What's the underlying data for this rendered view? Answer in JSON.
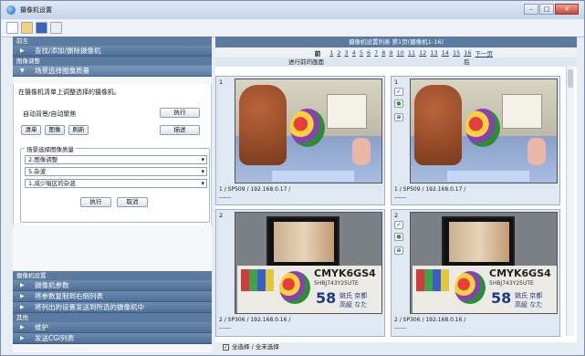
{
  "window": {
    "title": "摄像机设置",
    "buttons": [
      "–",
      "□",
      "✕"
    ]
  },
  "toolbar": {
    "icons": [
      "new-icon",
      "open-icon",
      "save-icon",
      "document-icon"
    ]
  },
  "left": {
    "sec_front": "前言",
    "item_find": "查找/添加/删除摄像机",
    "sec_image": "图像调整",
    "item_scene": "场景选择图像质量",
    "note": "在摄像机清单上调整选择的摄像机。",
    "auto_label": "自动背景/自动聚焦",
    "btn_exec1": "执行",
    "btn_clear": "清单",
    "btn_image": "图像",
    "btn_refresh": "刷新",
    "btn_describe": "描述",
    "group_legend": "场景选择图像质量",
    "select1": "2.图像调整",
    "select2": "5.杂波",
    "select3": "1.减少暗区的杂波",
    "btn_exec2": "执行",
    "btn_cancel": "取消",
    "sec_cam": "摄像机设置",
    "item_params": "摄像机参数",
    "item_copy": "将参数复制到右侧列表",
    "item_send": "将列出的设置发送到所选的摄像机中",
    "sec_other": "其他",
    "item_maint": "维护",
    "item_cgi": "发送CGI列表"
  },
  "right": {
    "header": "摄像机设置列表 第1页(摄像机1-16)",
    "pager_first": "前",
    "pages": [
      "1",
      "2",
      "3",
      "4",
      "5",
      "6",
      "7",
      "8",
      "9",
      "10",
      "11",
      "12",
      "13",
      "14",
      "15",
      "16",
      "下一页"
    ],
    "col_before": "进行前的画面",
    "col_after": "后",
    "cells": [
      {
        "num": "1",
        "caption": "1 / SP509 / 192.168.0.17 /",
        "caption2": "------"
      },
      {
        "num": "1",
        "caption": "1 / SP509 / 192.168.0.17 /",
        "caption2": "------"
      },
      {
        "num": "2",
        "caption": "2 / SP306 / 192.168.0.16 /",
        "caption2": "------"
      },
      {
        "num": "2",
        "caption": "2 / SP306 / 192.168.0.16 /",
        "caption2": "------"
      }
    ],
    "cmyk": "CMYK6GS4",
    "photo_text": "5HBJ743Y25UTE",
    "plate": "58",
    "plate_text": "姚氏 京都\n高級 なた",
    "footer": "全选择 / 全未选择"
  },
  "colors": {
    "nav": "#5b7a9f",
    "accent": "#1b3f9e"
  }
}
